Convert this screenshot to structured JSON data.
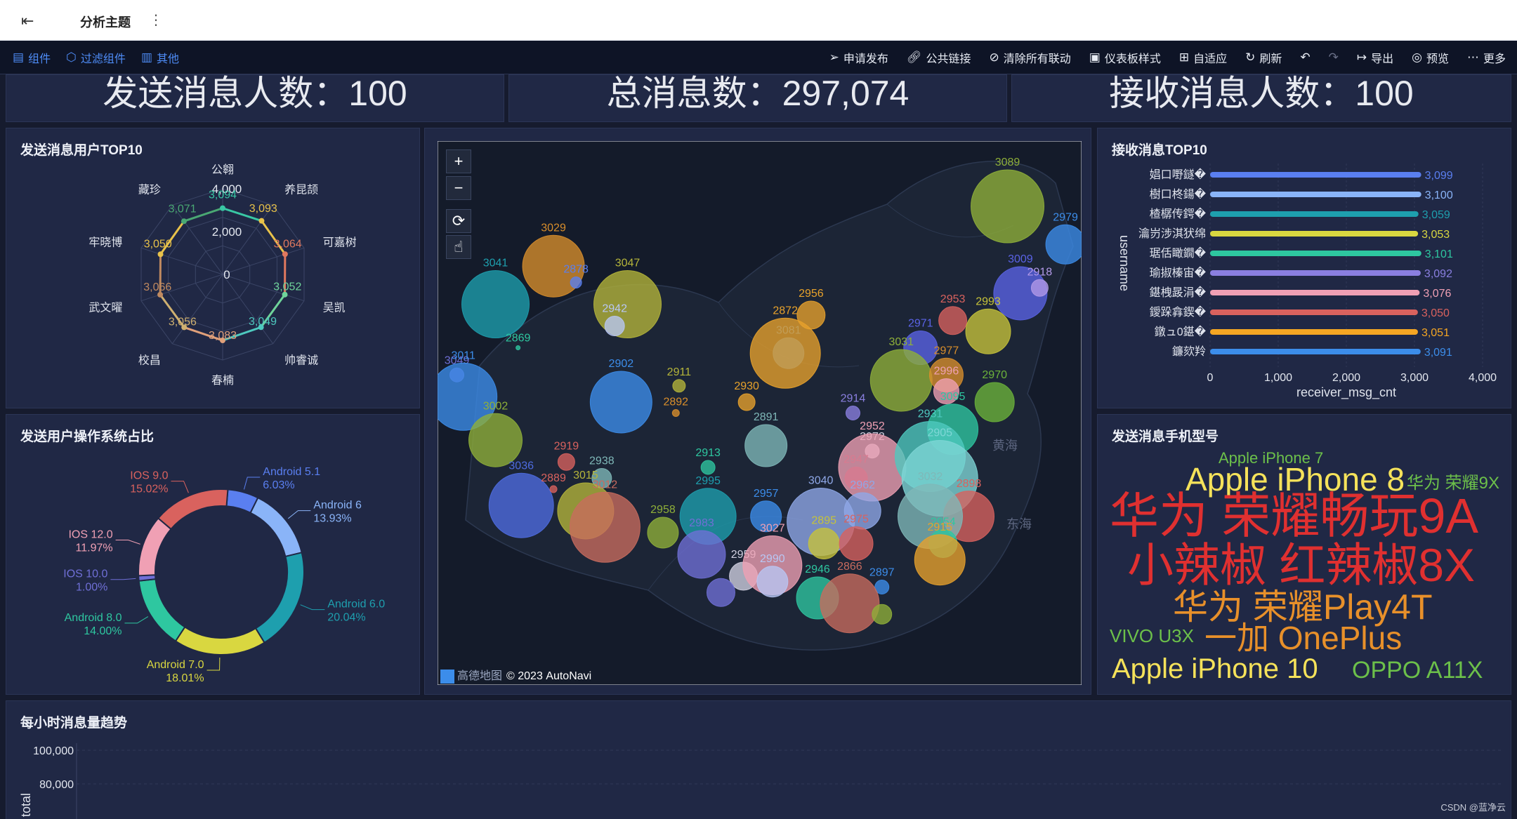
{
  "topbar": {
    "title": "分析主题",
    "back_icon": "exit-icon",
    "more_icon": "kebab-icon"
  },
  "toolbar": {
    "left": [
      {
        "label": "组件",
        "icon": "component-icon"
      },
      {
        "label": "过滤组件",
        "icon": "filter-icon"
      },
      {
        "label": "其他",
        "icon": "other-icon"
      }
    ],
    "right": [
      {
        "label": "申请发布",
        "icon": "send-icon"
      },
      {
        "label": "公共链接",
        "icon": "link-icon"
      },
      {
        "label": "清除所有联动",
        "icon": "unlink-icon"
      },
      {
        "label": "仪表板样式",
        "icon": "style-icon"
      },
      {
        "label": "自适应",
        "icon": "grid-icon"
      },
      {
        "label": "刷新",
        "icon": "refresh-icon"
      },
      {
        "label": "",
        "icon": "undo-icon"
      },
      {
        "label": "",
        "icon": "redo-icon"
      },
      {
        "label": "导出",
        "icon": "export-icon"
      },
      {
        "label": "预览",
        "icon": "preview-icon"
      },
      {
        "label": "更多",
        "icon": "more-icon"
      }
    ]
  },
  "kpis": [
    "发送消息人数：100",
    "总消息数：297,074",
    "接收消息人数：100"
  ],
  "panels": {
    "radar": "发送消息用户TOP10",
    "donut": "发送用户操作系统占比",
    "receive": "接收消息TOP10",
    "phones": "发送消息手机型号",
    "hourly": "每小时消息量趋势"
  },
  "colors": {
    "bg": "#161b2e",
    "panel": "#202845",
    "accent": "#4e8cf7"
  },
  "chart_data": [
    {
      "type": "radar",
      "indicators": [
        "公翱",
        "养昆颉",
        "可嘉树",
        "吴凯",
        "帅睿诚",
        "春楠",
        "校昌",
        "武文曜",
        "牢晓博",
        "藏珍"
      ],
      "values": [
        3094,
        3093,
        3064,
        3052,
        3049,
        3083,
        3056,
        3066,
        3050,
        3071
      ],
      "value_labels": [
        "3,094",
        "3,093",
        "3,064",
        "3,052",
        "3,049",
        "3,083",
        "3,056",
        "3,066",
        "3,050",
        "3,071"
      ],
      "ticks": [
        "0",
        "2,000",
        "4,000"
      ],
      "max": 4000,
      "colors": [
        "#39c7a4",
        "#e8c24a",
        "#e0785e",
        "#6fd39a",
        "#4ec9bf",
        "#e0a07a",
        "#cfb070",
        "#c08a60",
        "#e8c24a",
        "#4aa873"
      ]
    },
    {
      "type": "pie",
      "donut": true,
      "slices": [
        {
          "name": "Android 5.1",
          "value": 6.03,
          "label": "6.03%",
          "color": "#5a7ff0"
        },
        {
          "name": "Android 6",
          "value": 13.93,
          "label": "13.93%",
          "color": "#8ab4f8"
        },
        {
          "name": "Android 6.0",
          "value": 20.04,
          "label": "20.04%",
          "color": "#1e9fae"
        },
        {
          "name": "Android 7.0",
          "value": 18.01,
          "label": "18.01%",
          "color": "#d9d740"
        },
        {
          "name": "Android 8.0",
          "value": 14.0,
          "label": "14.00%",
          "color": "#2ec7a0"
        },
        {
          "name": "IOS 10.0",
          "value": 1.0,
          "label": "1.00%",
          "color": "#6f6fd6"
        },
        {
          "name": "IOS 12.0",
          "value": 11.97,
          "label": "11.97%",
          "color": "#f0a0b4"
        },
        {
          "name": "IOS 9.0",
          "value": 15.02,
          "label": "15.02%",
          "color": "#d9625e"
        }
      ]
    },
    {
      "type": "bar",
      "orientation": "horizontal",
      "categories": [
        "娼口嘢鐩�",
        "樹口柊鍚�",
        "楂樼传鍔�",
        "瀹岃涉淇犾绵",
        "琚佸瞰鐗�",
        "瑜掓榛宙�",
        "鍖栧晸涓�",
        "鑀跺搻鍥�",
        "鐓ュ0鍖�",
        "鐮欬羚"
      ],
      "values": [
        3099,
        3100,
        3059,
        3053,
        3101,
        3092,
        3076,
        3050,
        3051,
        3091
      ],
      "value_labels": [
        "3,099",
        "3,100",
        "3,059",
        "3,053",
        "3,101",
        "3,092",
        "3,076",
        "3,050",
        "3,051",
        "3,091"
      ],
      "colors": [
        "#5a7ff0",
        "#8ab4f8",
        "#1e9fae",
        "#d9d740",
        "#2ec7a0",
        "#8a7fe0",
        "#f0a0b4",
        "#d9625e",
        "#f5a623",
        "#3c8dea"
      ],
      "xlabel": "receiver_msg_cnt",
      "ylabel": "username",
      "xticks": [
        "0",
        "1,000",
        "2,000",
        "3,000",
        "4,000"
      ],
      "xlim": [
        0,
        4000
      ]
    },
    {
      "type": "scatter",
      "subtype": "bubble-map",
      "sea_labels": [
        "黄海",
        "东海"
      ],
      "attribution": "© 2023 AutoNavi",
      "brand": "高德地图",
      "points": [
        {
          "label": "3089",
          "x": 0.885,
          "y": 0.12,
          "r": 52,
          "c": "#8fb039"
        },
        {
          "label": "2979",
          "x": 0.975,
          "y": 0.19,
          "r": 28,
          "c": "#3c8dea"
        },
        {
          "label": "3009",
          "x": 0.905,
          "y": 0.28,
          "r": 38,
          "c": "#5a63e6"
        },
        {
          "label": "2918",
          "x": 0.935,
          "y": 0.27,
          "r": 12,
          "c": "#b39ae8"
        },
        {
          "label": "3029",
          "x": 0.18,
          "y": 0.23,
          "r": 44,
          "c": "#d98e2b"
        },
        {
          "label": "3041",
          "x": 0.09,
          "y": 0.3,
          "r": 48,
          "c": "#1e9fae"
        },
        {
          "label": "2878",
          "x": 0.215,
          "y": 0.26,
          "r": 8,
          "c": "#5a7ff0"
        },
        {
          "label": "3047",
          "x": 0.295,
          "y": 0.3,
          "r": 48,
          "c": "#b5b53a"
        },
        {
          "label": "2942",
          "x": 0.275,
          "y": 0.34,
          "r": 14,
          "c": "#b8c7f5"
        },
        {
          "label": "2869",
          "x": 0.125,
          "y": 0.38,
          "r": 3,
          "c": "#2ec7a0"
        },
        {
          "label": "3049",
          "x": 0.03,
          "y": 0.43,
          "r": 10,
          "c": "#6f6fd6"
        },
        {
          "label": "3011",
          "x": 0.04,
          "y": 0.47,
          "r": 48,
          "c": "#3c8dea"
        },
        {
          "label": "3002",
          "x": 0.09,
          "y": 0.55,
          "r": 38,
          "c": "#8fb039"
        },
        {
          "label": "2956",
          "x": 0.58,
          "y": 0.32,
          "r": 20,
          "c": "#e8a22b"
        },
        {
          "label": "3081",
          "x": 0.545,
          "y": 0.39,
          "r": 22,
          "c": "#3c8dea"
        },
        {
          "label": "2872",
          "x": 0.54,
          "y": 0.39,
          "r": 50,
          "c": "#e8a22b"
        },
        {
          "label": "2953",
          "x": 0.8,
          "y": 0.33,
          "r": 20,
          "c": "#d9625e"
        },
        {
          "label": "2993",
          "x": 0.855,
          "y": 0.35,
          "r": 32,
          "c": "#c6c33a"
        },
        {
          "label": "2971",
          "x": 0.75,
          "y": 0.38,
          "r": 24,
          "c": "#5a63e6"
        },
        {
          "label": "3031",
          "x": 0.72,
          "y": 0.44,
          "r": 44,
          "c": "#8fb039"
        },
        {
          "label": "2977",
          "x": 0.79,
          "y": 0.43,
          "r": 24,
          "c": "#d98e2b"
        },
        {
          "label": "2996",
          "x": 0.79,
          "y": 0.46,
          "r": 18,
          "c": "#f0a0b4"
        },
        {
          "label": "2970",
          "x": 0.865,
          "y": 0.48,
          "r": 28,
          "c": "#6cb33a"
        },
        {
          "label": "2902",
          "x": 0.285,
          "y": 0.48,
          "r": 44,
          "c": "#3c8dea"
        },
        {
          "label": "2911",
          "x": 0.375,
          "y": 0.45,
          "r": 9,
          "c": "#b5b53a"
        },
        {
          "label": "2892",
          "x": 0.37,
          "y": 0.5,
          "r": 5,
          "c": "#d98e2b"
        },
        {
          "label": "2930",
          "x": 0.48,
          "y": 0.48,
          "r": 12,
          "c": "#e8a22b"
        },
        {
          "label": "2914",
          "x": 0.645,
          "y": 0.5,
          "r": 10,
          "c": "#8a7fe0"
        },
        {
          "label": "3095",
          "x": 0.8,
          "y": 0.53,
          "r": 36,
          "c": "#2ec7a0"
        },
        {
          "label": "2891",
          "x": 0.51,
          "y": 0.56,
          "r": 30,
          "c": "#7fb8b8"
        },
        {
          "label": "2972",
          "x": 0.675,
          "y": 0.57,
          "r": 10,
          "c": "#d0d0e0"
        },
        {
          "label": "2919",
          "x": 0.2,
          "y": 0.59,
          "r": 12,
          "c": "#d9625e"
        },
        {
          "label": "2913",
          "x": 0.42,
          "y": 0.6,
          "r": 10,
          "c": "#2ec7a0"
        },
        {
          "label": "3036",
          "x": 0.13,
          "y": 0.67,
          "r": 46,
          "c": "#4e6be0"
        },
        {
          "label": "2938",
          "x": 0.255,
          "y": 0.62,
          "r": 14,
          "c": "#7fb8b8"
        },
        {
          "label": "2889",
          "x": 0.18,
          "y": 0.64,
          "r": 5,
          "c": "#d9625e"
        },
        {
          "label": "3015",
          "x": 0.23,
          "y": 0.68,
          "r": 40,
          "c": "#b5b53a"
        },
        {
          "label": "3012",
          "x": 0.26,
          "y": 0.71,
          "r": 50,
          "c": "#c96b5e"
        },
        {
          "label": "2952",
          "x": 0.675,
          "y": 0.6,
          "r": 48,
          "c": "#f0a0b4"
        },
        {
          "label": "2931",
          "x": 0.765,
          "y": 0.58,
          "r": 50,
          "c": "#4ec9bf"
        },
        {
          "label": "2905",
          "x": 0.78,
          "y": 0.62,
          "r": 54,
          "c": "#7fd6d6"
        },
        {
          "label": "2947",
          "x": 0.65,
          "y": 0.62,
          "r": 16,
          "c": "#d97a8f"
        },
        {
          "label": "2898",
          "x": 0.825,
          "y": 0.69,
          "r": 36,
          "c": "#d9625e"
        },
        {
          "label": "3032",
          "x": 0.765,
          "y": 0.69,
          "r": 46,
          "c": "#7fb8b8"
        },
        {
          "label": "2962",
          "x": 0.66,
          "y": 0.68,
          "r": 26,
          "c": "#8fa8e8"
        },
        {
          "label": "3040",
          "x": 0.595,
          "y": 0.7,
          "r": 48,
          "c": "#8fa8e8"
        },
        {
          "label": "2958",
          "x": 0.35,
          "y": 0.72,
          "r": 22,
          "c": "#8fb039"
        },
        {
          "label": "2957",
          "x": 0.51,
          "y": 0.69,
          "r": 22,
          "c": "#3c8dea"
        },
        {
          "label": "2995",
          "x": 0.42,
          "y": 0.69,
          "r": 40,
          "c": "#1e9fae"
        },
        {
          "label": "2983",
          "x": 0.41,
          "y": 0.76,
          "r": 34,
          "c": "#6f6fd6"
        },
        {
          "label": "2959",
          "x": 0.475,
          "y": 0.8,
          "r": 20,
          "c": "#d0d0e0"
        },
        {
          "label": "3027",
          "x": 0.52,
          "y": 0.78,
          "r": 42,
          "c": "#f0a0b4"
        },
        {
          "label": "2990",
          "x": 0.52,
          "y": 0.81,
          "r": 22,
          "c": "#b8c7f5"
        },
        {
          "label": "2895",
          "x": 0.6,
          "y": 0.74,
          "r": 22,
          "c": "#c6c33a"
        },
        {
          "label": "2975",
          "x": 0.65,
          "y": 0.74,
          "r": 24,
          "c": "#d9625e"
        },
        {
          "label": "2946",
          "x": 0.59,
          "y": 0.84,
          "r": 30,
          "c": "#2ec7a0"
        },
        {
          "label": "2954",
          "x": 0.785,
          "y": 0.74,
          "r": 20,
          "c": "#2ec7a0"
        },
        {
          "label": "2915",
          "x": 0.78,
          "y": 0.77,
          "r": 36,
          "c": "#e8a22b"
        },
        {
          "label": "2897",
          "x": 0.69,
          "y": 0.82,
          "r": 10,
          "c": "#3c8dea"
        },
        {
          "label": "2866",
          "x": 0.64,
          "y": 0.85,
          "r": 42,
          "c": "#c96b5e"
        },
        {
          "label": "",
          "x": 0.69,
          "y": 0.87,
          "r": 14,
          "c": "#8fb039"
        },
        {
          "label": "",
          "x": 0.44,
          "y": 0.83,
          "r": 20,
          "c": "#6f6fd6"
        }
      ]
    },
    {
      "type": "table",
      "subtype": "word-cloud",
      "words": [
        {
          "text": "Apple iPhone 7",
          "x": 1735,
          "y": 642,
          "size": 22,
          "color": "#6cc04a"
        },
        {
          "text": "Apple iPhone 8",
          "x": 1688,
          "y": 660,
          "size": 46,
          "color": "#f5e25a"
        },
        {
          "text": "华为 荣耀9X",
          "x": 2003,
          "y": 677,
          "size": 24,
          "color": "#6cc04a"
        },
        {
          "text": "华为 荣耀畅玩9A",
          "x": 1580,
          "y": 700,
          "size": 70,
          "color": "#e03030"
        },
        {
          "text": "小辣椒 红辣椒8X",
          "x": 1605,
          "y": 772,
          "size": 66,
          "color": "#e03030"
        },
        {
          "text": "华为 荣耀Play4T",
          "x": 1670,
          "y": 840,
          "size": 50,
          "color": "#e8902a"
        },
        {
          "text": "VIVO U3X",
          "x": 1580,
          "y": 893,
          "size": 26,
          "color": "#6cc04a"
        },
        {
          "text": "一加 OnePlus",
          "x": 1715,
          "y": 886,
          "size": 46,
          "color": "#e8902a"
        },
        {
          "text": "Apple iPhone 10",
          "x": 1583,
          "y": 933,
          "size": 40,
          "color": "#f5e25a"
        },
        {
          "text": "OPPO A11X",
          "x": 1925,
          "y": 938,
          "size": 34,
          "color": "#6cc04a"
        }
      ]
    },
    {
      "type": "line",
      "ylabel": "total",
      "yticks": [
        "100,000",
        "80,000"
      ],
      "series": []
    }
  ],
  "footer": "CSDN @蓝净云"
}
